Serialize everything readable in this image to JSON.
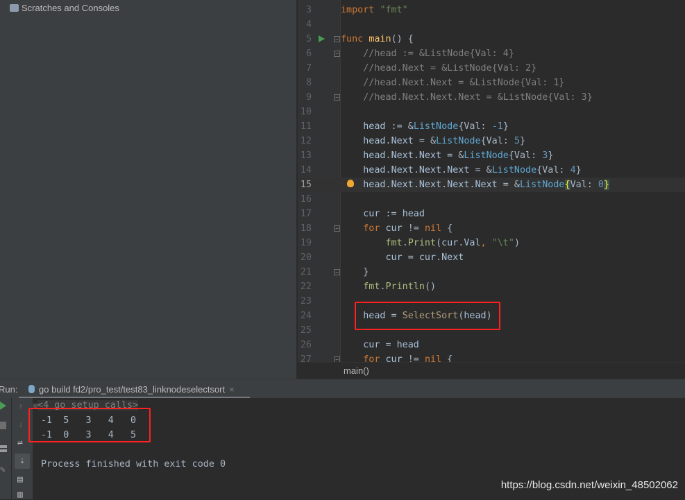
{
  "project": {
    "scratches_label": "Scratches and Consoles"
  },
  "editor": {
    "current_line": 15,
    "lines": [
      {
        "num": "3",
        "tokens": [
          [
            "k",
            "import "
          ],
          [
            "s",
            "\"fmt\""
          ]
        ]
      },
      {
        "num": "4",
        "tokens": []
      },
      {
        "num": "5",
        "run": true,
        "fold": true,
        "tokens": [
          [
            "k",
            "func "
          ],
          [
            "fn",
            "main"
          ],
          [
            "p",
            "() {"
          ]
        ]
      },
      {
        "num": "6",
        "fold": true,
        "tokens": [
          [
            "c",
            "    //head := &ListNode{Val: 4}"
          ]
        ]
      },
      {
        "num": "7",
        "tokens": [
          [
            "c",
            "    //head.Next = &ListNode{Val: 2}"
          ]
        ]
      },
      {
        "num": "8",
        "tokens": [
          [
            "c",
            "    //head.Next.Next = &ListNode{Val: 1}"
          ]
        ]
      },
      {
        "num": "9",
        "fold": true,
        "tokens": [
          [
            "c",
            "    //head.Next.Next.Next = &ListNode{Val: 3}"
          ]
        ]
      },
      {
        "num": "10",
        "tokens": []
      },
      {
        "num": "11",
        "tokens": [
          [
            "v",
            "    head"
          ],
          [
            "p",
            " := &"
          ],
          [
            "t",
            "ListNode"
          ],
          [
            "p",
            "{Val: "
          ],
          [
            "n",
            "-1"
          ],
          [
            "p",
            "}"
          ]
        ]
      },
      {
        "num": "12",
        "tokens": [
          [
            "v",
            "    head"
          ],
          [
            "p",
            "."
          ],
          [
            "v",
            "Next"
          ],
          [
            "p",
            " = &"
          ],
          [
            "t",
            "ListNode"
          ],
          [
            "p",
            "{Val: "
          ],
          [
            "n",
            "5"
          ],
          [
            "p",
            "}"
          ]
        ]
      },
      {
        "num": "13",
        "tokens": [
          [
            "v",
            "    head"
          ],
          [
            "p",
            "."
          ],
          [
            "v",
            "Next"
          ],
          [
            "p",
            "."
          ],
          [
            "v",
            "Next"
          ],
          [
            "p",
            " = &"
          ],
          [
            "t",
            "ListNode"
          ],
          [
            "p",
            "{Val: "
          ],
          [
            "n",
            "3"
          ],
          [
            "p",
            "}"
          ]
        ]
      },
      {
        "num": "14",
        "tokens": [
          [
            "v",
            "    head"
          ],
          [
            "p",
            "."
          ],
          [
            "v",
            "Next"
          ],
          [
            "p",
            "."
          ],
          [
            "v",
            "Next"
          ],
          [
            "p",
            "."
          ],
          [
            "v",
            "Next"
          ],
          [
            "p",
            " = &"
          ],
          [
            "t",
            "ListNode"
          ],
          [
            "p",
            "{Val: "
          ],
          [
            "n",
            "4"
          ],
          [
            "p",
            "}"
          ]
        ]
      },
      {
        "num": "15",
        "bulb": true,
        "tokens": [
          [
            "v",
            "    head"
          ],
          [
            "p",
            "."
          ],
          [
            "v",
            "Next"
          ],
          [
            "p",
            "."
          ],
          [
            "v",
            "Next"
          ],
          [
            "p",
            "."
          ],
          [
            "v",
            "Next"
          ],
          [
            "p",
            "."
          ],
          [
            "v",
            "Next"
          ],
          [
            "p",
            " = &"
          ],
          [
            "t",
            "ListNode"
          ],
          [
            "br",
            "{"
          ],
          [
            "p",
            "Val: "
          ],
          [
            "n",
            "0"
          ],
          [
            "br",
            "}"
          ]
        ]
      },
      {
        "num": "16",
        "tokens": []
      },
      {
        "num": "17",
        "tokens": [
          [
            "v",
            "    cur"
          ],
          [
            "p",
            " := "
          ],
          [
            "v",
            "head"
          ]
        ]
      },
      {
        "num": "18",
        "fold": true,
        "tokens": [
          [
            "k",
            "    for "
          ],
          [
            "v",
            "cur"
          ],
          [
            "p",
            " != "
          ],
          [
            "k",
            "nil"
          ],
          [
            "p",
            " {"
          ]
        ]
      },
      {
        "num": "19",
        "tokens": [
          [
            "pk",
            "        fmt"
          ],
          [
            "p",
            "."
          ],
          [
            "pk",
            "Print"
          ],
          [
            "p",
            "("
          ],
          [
            "v",
            "cur"
          ],
          [
            "p",
            "."
          ],
          [
            "v",
            "Val"
          ],
          [
            "k",
            ", "
          ],
          [
            "s",
            "\"\\t\""
          ],
          [
            "p",
            ")"
          ]
        ]
      },
      {
        "num": "20",
        "tokens": [
          [
            "v",
            "        cur"
          ],
          [
            "p",
            " = "
          ],
          [
            "v",
            "cur"
          ],
          [
            "p",
            "."
          ],
          [
            "v",
            "Next"
          ]
        ]
      },
      {
        "num": "21",
        "fold": true,
        "tokens": [
          [
            "p",
            "    }"
          ]
        ]
      },
      {
        "num": "22",
        "tokens": [
          [
            "pk",
            "    fmt"
          ],
          [
            "p",
            "."
          ],
          [
            "pk",
            "Println"
          ],
          [
            "p",
            "()"
          ]
        ]
      },
      {
        "num": "23",
        "tokens": []
      },
      {
        "num": "24",
        "tokens": [
          [
            "v",
            "    head"
          ],
          [
            "p",
            " = "
          ],
          [
            "call",
            "SelectSort"
          ],
          [
            "p",
            "("
          ],
          [
            "v",
            "head"
          ],
          [
            "p",
            ")"
          ]
        ]
      },
      {
        "num": "25",
        "tokens": []
      },
      {
        "num": "26",
        "tokens": [
          [
            "v",
            "    cur"
          ],
          [
            "p",
            " = "
          ],
          [
            "v",
            "head"
          ]
        ]
      },
      {
        "num": "27",
        "fold": true,
        "tokens": [
          [
            "k",
            "    for "
          ],
          [
            "v",
            "cur"
          ],
          [
            "p",
            " != "
          ],
          [
            "k",
            "nil"
          ],
          [
            "p",
            " {"
          ]
        ]
      }
    ],
    "breadcrumb": "main()"
  },
  "run": {
    "label": "Run:",
    "tab_title": "go build fd2/pro_test/test83_linknodeselectsort",
    "close": "×",
    "output": {
      "setup_calls": "<4 go setup calls>",
      "lines": [
        "-1  5   3   4   0",
        "-1  0   3   4   5"
      ],
      "exit": "Process finished with exit code 0"
    }
  },
  "watermark": "https://blog.csdn.net/weixin_48502062",
  "colors": {
    "highlight_box": "#ff2020",
    "keyword": "#cc7832",
    "string": "#6a8759",
    "number": "#6897bb"
  }
}
